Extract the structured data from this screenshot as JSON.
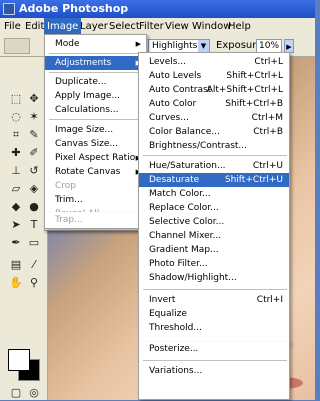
{
  "window": {
    "title": "Adobe Photoshop"
  },
  "menubar": {
    "items": [
      "File",
      "Edit",
      "Image",
      "Layer",
      "Select",
      "Filter",
      "View",
      "Window",
      "Help"
    ],
    "active": "Image"
  },
  "options": {
    "range_value": "Highlights",
    "exposure_label": "Exposure:",
    "exposure_value": "10%"
  },
  "image_menu": {
    "mode": "Mode",
    "adjustments": "Adjustments",
    "duplicate": "Duplicate...",
    "apply_image": "Apply Image...",
    "calculations": "Calculations...",
    "image_size": "Image Size...",
    "canvas_size": "Canvas Size...",
    "pixel_aspect_ratio": "Pixel Aspect Ratio",
    "rotate_canvas": "Rotate Canvas",
    "crop": "Crop",
    "trim": "Trim...",
    "reveal_all": "Reveal All",
    "trap": "Trap..."
  },
  "adjustments_menu": {
    "levels": {
      "label": "Levels...",
      "shortcut": "Ctrl+L"
    },
    "auto_levels": {
      "label": "Auto Levels",
      "shortcut": "Shift+Ctrl+L"
    },
    "auto_contrast": {
      "label": "Auto Contrast",
      "shortcut": "Alt+Shift+Ctrl+L"
    },
    "auto_color": {
      "label": "Auto Color",
      "shortcut": "Shift+Ctrl+B"
    },
    "curves": {
      "label": "Curves...",
      "shortcut": "Ctrl+M"
    },
    "color_balance": {
      "label": "Color Balance...",
      "shortcut": "Ctrl+B"
    },
    "brightness_contrast": {
      "label": "Brightness/Contrast..."
    },
    "hue_saturation": {
      "label": "Hue/Saturation...",
      "shortcut": "Ctrl+U"
    },
    "desaturate": {
      "label": "Desaturate",
      "shortcut": "Shift+Ctrl+U"
    },
    "match_color": {
      "label": "Match Color..."
    },
    "replace_color": {
      "label": "Replace Color..."
    },
    "selective_color": {
      "label": "Selective Color..."
    },
    "channel_mixer": {
      "label": "Channel Mixer..."
    },
    "gradient_map": {
      "label": "Gradient Map..."
    },
    "photo_filter": {
      "label": "Photo Filter..."
    },
    "shadow_highlight": {
      "label": "Shadow/Highlight..."
    },
    "invert": {
      "label": "Invert",
      "shortcut": "Ctrl+I"
    },
    "equalize": {
      "label": "Equalize"
    },
    "threshold": {
      "label": "Threshold..."
    },
    "posterize": {
      "label": "Posterize..."
    },
    "variations": {
      "label": "Variations..."
    }
  }
}
